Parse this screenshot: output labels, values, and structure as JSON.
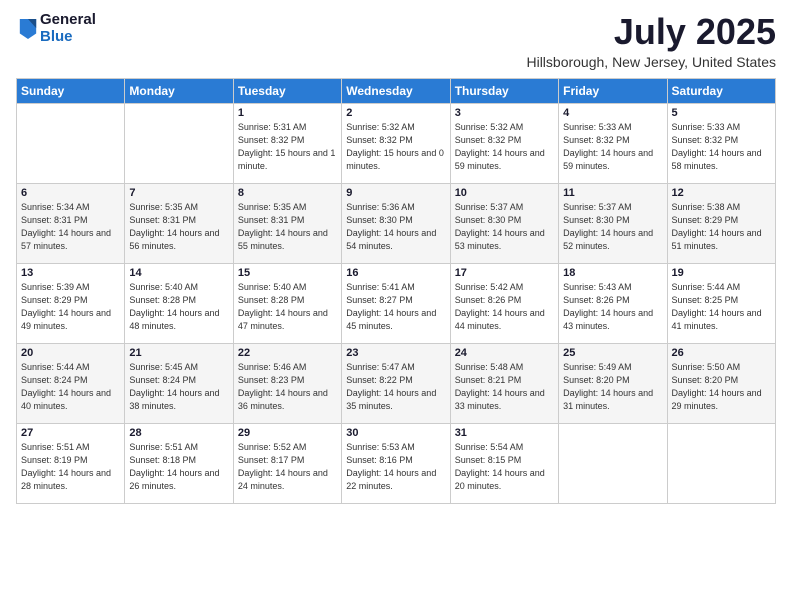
{
  "logo": {
    "general": "General",
    "blue": "Blue"
  },
  "header": {
    "month": "July 2025",
    "location": "Hillsborough, New Jersey, United States"
  },
  "days_of_week": [
    "Sunday",
    "Monday",
    "Tuesday",
    "Wednesday",
    "Thursday",
    "Friday",
    "Saturday"
  ],
  "weeks": [
    [
      {
        "day": "",
        "sunrise": "",
        "sunset": "",
        "daylight": ""
      },
      {
        "day": "",
        "sunrise": "",
        "sunset": "",
        "daylight": ""
      },
      {
        "day": "1",
        "sunrise": "Sunrise: 5:31 AM",
        "sunset": "Sunset: 8:32 PM",
        "daylight": "Daylight: 15 hours and 1 minute."
      },
      {
        "day": "2",
        "sunrise": "Sunrise: 5:32 AM",
        "sunset": "Sunset: 8:32 PM",
        "daylight": "Daylight: 15 hours and 0 minutes."
      },
      {
        "day": "3",
        "sunrise": "Sunrise: 5:32 AM",
        "sunset": "Sunset: 8:32 PM",
        "daylight": "Daylight: 14 hours and 59 minutes."
      },
      {
        "day": "4",
        "sunrise": "Sunrise: 5:33 AM",
        "sunset": "Sunset: 8:32 PM",
        "daylight": "Daylight: 14 hours and 59 minutes."
      },
      {
        "day": "5",
        "sunrise": "Sunrise: 5:33 AM",
        "sunset": "Sunset: 8:32 PM",
        "daylight": "Daylight: 14 hours and 58 minutes."
      }
    ],
    [
      {
        "day": "6",
        "sunrise": "Sunrise: 5:34 AM",
        "sunset": "Sunset: 8:31 PM",
        "daylight": "Daylight: 14 hours and 57 minutes."
      },
      {
        "day": "7",
        "sunrise": "Sunrise: 5:35 AM",
        "sunset": "Sunset: 8:31 PM",
        "daylight": "Daylight: 14 hours and 56 minutes."
      },
      {
        "day": "8",
        "sunrise": "Sunrise: 5:35 AM",
        "sunset": "Sunset: 8:31 PM",
        "daylight": "Daylight: 14 hours and 55 minutes."
      },
      {
        "day": "9",
        "sunrise": "Sunrise: 5:36 AM",
        "sunset": "Sunset: 8:30 PM",
        "daylight": "Daylight: 14 hours and 54 minutes."
      },
      {
        "day": "10",
        "sunrise": "Sunrise: 5:37 AM",
        "sunset": "Sunset: 8:30 PM",
        "daylight": "Daylight: 14 hours and 53 minutes."
      },
      {
        "day": "11",
        "sunrise": "Sunrise: 5:37 AM",
        "sunset": "Sunset: 8:30 PM",
        "daylight": "Daylight: 14 hours and 52 minutes."
      },
      {
        "day": "12",
        "sunrise": "Sunrise: 5:38 AM",
        "sunset": "Sunset: 8:29 PM",
        "daylight": "Daylight: 14 hours and 51 minutes."
      }
    ],
    [
      {
        "day": "13",
        "sunrise": "Sunrise: 5:39 AM",
        "sunset": "Sunset: 8:29 PM",
        "daylight": "Daylight: 14 hours and 49 minutes."
      },
      {
        "day": "14",
        "sunrise": "Sunrise: 5:40 AM",
        "sunset": "Sunset: 8:28 PM",
        "daylight": "Daylight: 14 hours and 48 minutes."
      },
      {
        "day": "15",
        "sunrise": "Sunrise: 5:40 AM",
        "sunset": "Sunset: 8:28 PM",
        "daylight": "Daylight: 14 hours and 47 minutes."
      },
      {
        "day": "16",
        "sunrise": "Sunrise: 5:41 AM",
        "sunset": "Sunset: 8:27 PM",
        "daylight": "Daylight: 14 hours and 45 minutes."
      },
      {
        "day": "17",
        "sunrise": "Sunrise: 5:42 AM",
        "sunset": "Sunset: 8:26 PM",
        "daylight": "Daylight: 14 hours and 44 minutes."
      },
      {
        "day": "18",
        "sunrise": "Sunrise: 5:43 AM",
        "sunset": "Sunset: 8:26 PM",
        "daylight": "Daylight: 14 hours and 43 minutes."
      },
      {
        "day": "19",
        "sunrise": "Sunrise: 5:44 AM",
        "sunset": "Sunset: 8:25 PM",
        "daylight": "Daylight: 14 hours and 41 minutes."
      }
    ],
    [
      {
        "day": "20",
        "sunrise": "Sunrise: 5:44 AM",
        "sunset": "Sunset: 8:24 PM",
        "daylight": "Daylight: 14 hours and 40 minutes."
      },
      {
        "day": "21",
        "sunrise": "Sunrise: 5:45 AM",
        "sunset": "Sunset: 8:24 PM",
        "daylight": "Daylight: 14 hours and 38 minutes."
      },
      {
        "day": "22",
        "sunrise": "Sunrise: 5:46 AM",
        "sunset": "Sunset: 8:23 PM",
        "daylight": "Daylight: 14 hours and 36 minutes."
      },
      {
        "day": "23",
        "sunrise": "Sunrise: 5:47 AM",
        "sunset": "Sunset: 8:22 PM",
        "daylight": "Daylight: 14 hours and 35 minutes."
      },
      {
        "day": "24",
        "sunrise": "Sunrise: 5:48 AM",
        "sunset": "Sunset: 8:21 PM",
        "daylight": "Daylight: 14 hours and 33 minutes."
      },
      {
        "day": "25",
        "sunrise": "Sunrise: 5:49 AM",
        "sunset": "Sunset: 8:20 PM",
        "daylight": "Daylight: 14 hours and 31 minutes."
      },
      {
        "day": "26",
        "sunrise": "Sunrise: 5:50 AM",
        "sunset": "Sunset: 8:20 PM",
        "daylight": "Daylight: 14 hours and 29 minutes."
      }
    ],
    [
      {
        "day": "27",
        "sunrise": "Sunrise: 5:51 AM",
        "sunset": "Sunset: 8:19 PM",
        "daylight": "Daylight: 14 hours and 28 minutes."
      },
      {
        "day": "28",
        "sunrise": "Sunrise: 5:51 AM",
        "sunset": "Sunset: 8:18 PM",
        "daylight": "Daylight: 14 hours and 26 minutes."
      },
      {
        "day": "29",
        "sunrise": "Sunrise: 5:52 AM",
        "sunset": "Sunset: 8:17 PM",
        "daylight": "Daylight: 14 hours and 24 minutes."
      },
      {
        "day": "30",
        "sunrise": "Sunrise: 5:53 AM",
        "sunset": "Sunset: 8:16 PM",
        "daylight": "Daylight: 14 hours and 22 minutes."
      },
      {
        "day": "31",
        "sunrise": "Sunrise: 5:54 AM",
        "sunset": "Sunset: 8:15 PM",
        "daylight": "Daylight: 14 hours and 20 minutes."
      },
      {
        "day": "",
        "sunrise": "",
        "sunset": "",
        "daylight": ""
      },
      {
        "day": "",
        "sunrise": "",
        "sunset": "",
        "daylight": ""
      }
    ]
  ]
}
